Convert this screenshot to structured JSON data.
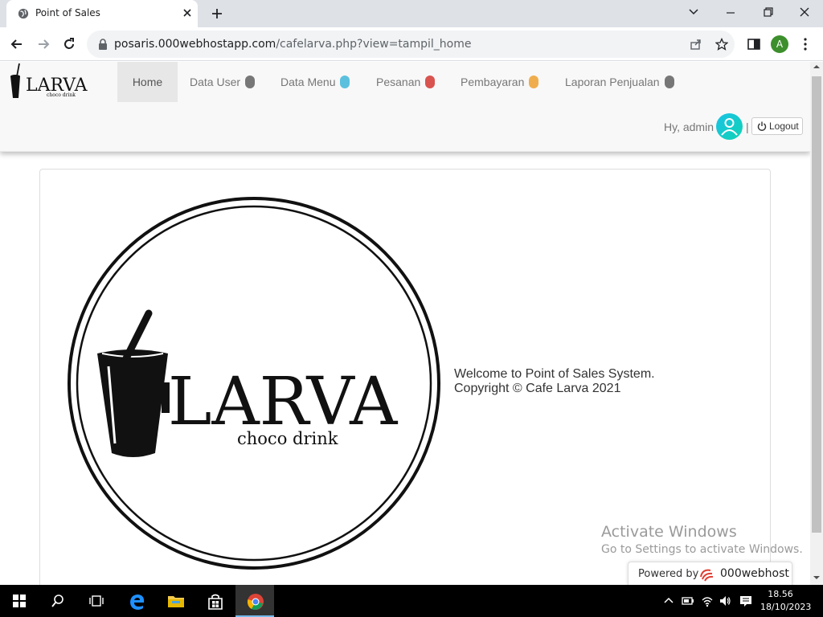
{
  "browser": {
    "tab_title": "Point of Sales",
    "url_host": "posaris.000webhostapp.com",
    "url_path": "/cafelarva.php?view=tampil_home",
    "profile_initial": "A"
  },
  "app": {
    "brand_name": "LARVA",
    "brand_tagline": "choco drink",
    "nav": [
      {
        "label": "Home",
        "dot": null
      },
      {
        "label": "Data User",
        "dot": "#777777"
      },
      {
        "label": "Data Menu",
        "dot": "#5bc0de"
      },
      {
        "label": "Pesanan",
        "dot": "#d9534f"
      },
      {
        "label": "Pembayaran",
        "dot": "#f0ad4e"
      },
      {
        "label": "Laporan Penjualan",
        "dot": "#777777"
      }
    ],
    "greeting": "Hy, admin",
    "separator": "|",
    "logout_label": "Logout"
  },
  "content": {
    "welcome_line1": "Welcome to Point of Sales System.",
    "welcome_line2": "Copyright © Cafe Larva 2021"
  },
  "overlay": {
    "activate_title": "Activate Windows",
    "activate_sub": "Go to Settings to activate Windows.",
    "powered_by": "Powered by",
    "powered_brand": "000webhost"
  },
  "taskbar": {
    "time": "18.56",
    "date": "18/10/2023"
  }
}
